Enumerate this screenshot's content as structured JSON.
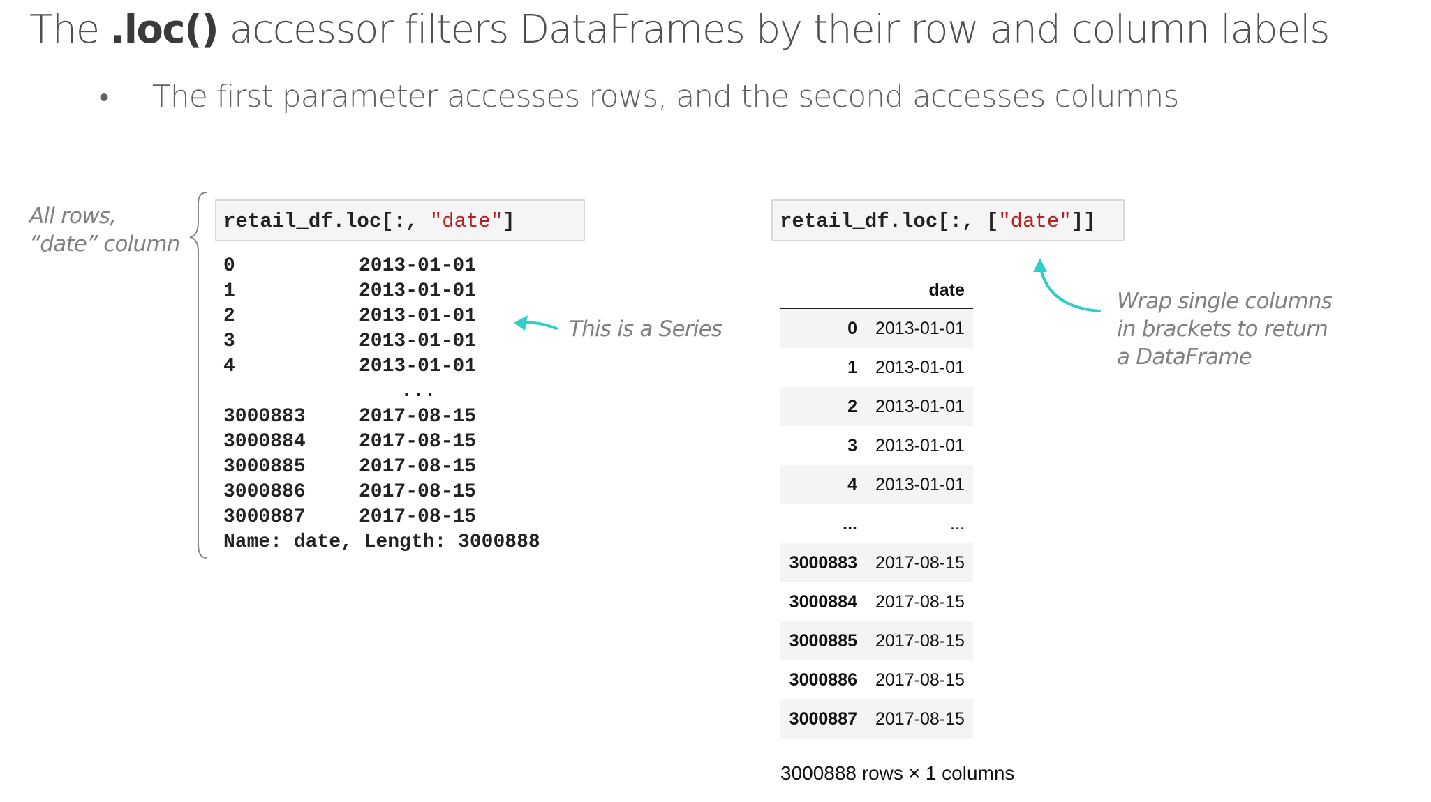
{
  "slide": {
    "title": {
      "before": "The ",
      "emphasis": ".loc()",
      "after": " accessor filters DataFrames by their row and column labels"
    },
    "bullet": "The first parameter accesses rows, and the second accesses columns",
    "bullet_marker": "•"
  },
  "left_note": {
    "line1": "All rows,",
    "line2": "“date” column"
  },
  "series_code": {
    "prefix": "retail_df.loc[:, ",
    "string": "\"date\"",
    "suffix": "]"
  },
  "series_output": {
    "rows": [
      {
        "index": "0",
        "value": "2013-01-01"
      },
      {
        "index": "1",
        "value": "2013-01-01"
      },
      {
        "index": "2",
        "value": "2013-01-01"
      },
      {
        "index": "3",
        "value": "2013-01-01"
      },
      {
        "index": "4",
        "value": "2013-01-01"
      },
      {
        "index": "",
        "value": "..."
      },
      {
        "index": "3000883",
        "value": "2017-08-15"
      },
      {
        "index": "3000884",
        "value": "2017-08-15"
      },
      {
        "index": "3000885",
        "value": "2017-08-15"
      },
      {
        "index": "3000886",
        "value": "2017-08-15"
      },
      {
        "index": "3000887",
        "value": "2017-08-15"
      }
    ],
    "footer": "Name: date, Length: 3000888"
  },
  "series_note": "This is a Series",
  "df_code": {
    "prefix": "retail_df.loc[:, [",
    "string": "\"date\"",
    "suffix": "]]"
  },
  "dataframe": {
    "column": "date",
    "rows": [
      {
        "index": "0",
        "value": "2013-01-01"
      },
      {
        "index": "1",
        "value": "2013-01-01"
      },
      {
        "index": "2",
        "value": "2013-01-01"
      },
      {
        "index": "3",
        "value": "2013-01-01"
      },
      {
        "index": "4",
        "value": "2013-01-01"
      },
      {
        "index": "...",
        "value": "..."
      },
      {
        "index": "3000883",
        "value": "2017-08-15"
      },
      {
        "index": "3000884",
        "value": "2017-08-15"
      },
      {
        "index": "3000885",
        "value": "2017-08-15"
      },
      {
        "index": "3000886",
        "value": "2017-08-15"
      },
      {
        "index": "3000887",
        "value": "2017-08-15"
      }
    ],
    "caption": "3000888 rows × 1 columns"
  },
  "df_note": {
    "line1": "Wrap single columns",
    "line2": "in brackets to return",
    "line3": "a DataFrame"
  },
  "colors": {
    "accent_arrow": "#2ecfc8",
    "string_literal": "#b22222"
  }
}
